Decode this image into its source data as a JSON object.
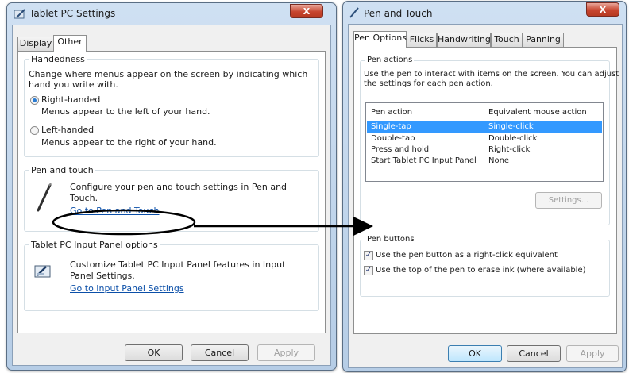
{
  "tablet_pc_settings": {
    "title": "Tablet PC Settings",
    "close_label": "X",
    "tabs": [
      "Display",
      "Other"
    ],
    "handedness": {
      "label": "Handedness",
      "description_line1": "Change where menus appear on the screen by indicating which",
      "description_line2": "hand you write with.",
      "right_label": "Right-handed",
      "right_desc": "Menus appear to the left of your hand.",
      "left_label": "Left-handed",
      "left_desc": "Menus appear to the right of your hand."
    },
    "pen_touch": {
      "label": "Pen and touch",
      "desc_line1": "Configure your pen and touch settings in Pen and",
      "desc_line2": "Touch.",
      "link": "Go to Pen and Touch"
    },
    "input_panel": {
      "label": "Tablet PC Input Panel options",
      "desc_line1": "Customize Tablet PC Input Panel features in Input",
      "desc_line2": "Panel Settings.",
      "link": "Go to Input Panel Settings"
    },
    "buttons": {
      "ok": "OK",
      "cancel": "Cancel",
      "apply": "Apply"
    }
  },
  "pen_and_touch": {
    "title": "Pen and Touch",
    "close_label": "X",
    "tabs": [
      "Pen Options",
      "Flicks",
      "Handwriting",
      "Touch",
      "Panning"
    ],
    "pen_actions": {
      "label": "Pen actions",
      "desc_line1": "Use the pen to interact with items on the screen.  You can adjust",
      "desc_line2": "the settings for each pen action.",
      "col_action": "Pen action",
      "col_equivalent": "Equivalent mouse action",
      "rows": [
        {
          "action": "Single-tap",
          "equivalent": "Single-click"
        },
        {
          "action": "Double-tap",
          "equivalent": "Double-click"
        },
        {
          "action": "Press and hold",
          "equivalent": "Right-click"
        },
        {
          "action": "Start Tablet PC Input Panel",
          "equivalent": "None"
        }
      ],
      "settings_button": "Settings..."
    },
    "pen_buttons": {
      "label": "Pen buttons",
      "option1": "Use the pen button as a right-click equivalent",
      "option2": "Use the top of the pen to erase ink (where available)"
    },
    "buttons": {
      "ok": "OK",
      "cancel": "Cancel",
      "apply": "Apply"
    }
  },
  "colors": {
    "link": "#0b4fa8",
    "selection": "#3399ff",
    "callout": "#000000"
  }
}
